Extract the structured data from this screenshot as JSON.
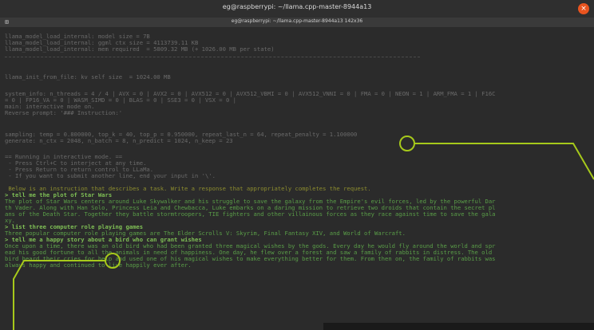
{
  "window": {
    "title": "eg@raspberrypi: ~/llama.cpp-master-8944a13",
    "tab_title": "eg@raspberrypi: ~/llama.cpp-master-8944a13 142x36",
    "close_glyph": "×"
  },
  "terminal": {
    "lines": [
      "llama_model_load_internal: model size = 7B",
      "llama_model_load_internal: ggml ctx size = 4113739.11 KB",
      "llama_model_load_internal: mem required  = 5809.32 MB (+ 1026.00 MB per state)",
      "llama_init_from_file: kv self size  = 1024.00 MB",
      "system_info: n_threads = 4 / 4 | AVX = 0 | AVX2 = 0 | AVX512 = 0 | AVX512_VBMI = 0 | AVX512_VNNI = 0 | FMA = 0 | NEON = 1 | ARM_FMA = 1 | F16C",
      "= 0 | FP16_VA = 0 | WASM_SIMD = 0 | BLAS = 0 | SSE3 = 0 | VSX = 0 |",
      "main: interactive mode on.",
      "Reverse prompt: '### Instruction:'",
      "sampling: temp = 0.800000, top_k = 40, top_p = 0.950000, repeat_last_n = 64, repeat_penalty = 1.100000",
      "generate: n_ctx = 2048, n_batch = 8, n_predict = 1024, n_keep = 23",
      "== Running in interactive mode. ==",
      " - Press Ctrl+C to interject at any time.",
      " - Press Return to return control to LLaMa.",
      " - If you want to submit another line, end your input in '\\'.",
      " Below is an instruction that describes a task. Write a response that appropriately completes the request.",
      "> tell me the plot of Star Wars",
      "The plot of Star Wars centers around Luke Skywalker and his struggle to save the galaxy from the Empire's evil forces, led by the powerful Dar",
      "th Vader. Along with Han Solo, Princess Leia and Chewbacca, Luke embarks on a daring mission to retrieve two droids that contain the secret pl",
      "ans of the Death Star. Together they battle stormtroopers, TIE fighters and other villainous forces as they race against time to save the gala",
      "xy.",
      "> list three computer role playing games",
      "Three popular computer role playing games are The Elder Scrolls V: Skyrim, Final Fantasy XIV, and World of Warcraft.",
      "> tell me a happy story about a bird who can grant wishes",
      "Once upon a time, there was an old bird who had been granted three magical wishes by the gods. Every day he would fly around the world and spr",
      "ead his good fortune to all the animals in need of happiness. One day, he flew over a forest and saw a family of rabbits in distress. The old",
      "bird heard their cries for help and used one of his magical wishes to make everything better for them. From then on, the family of rabbits was",
      "always happy and continued to live happily ever after."
    ]
  },
  "colors": {
    "background": "#2b2b2b",
    "text": "#6a6a6a",
    "prompt": "#7fbf55",
    "callout": "#a6c91b"
  }
}
